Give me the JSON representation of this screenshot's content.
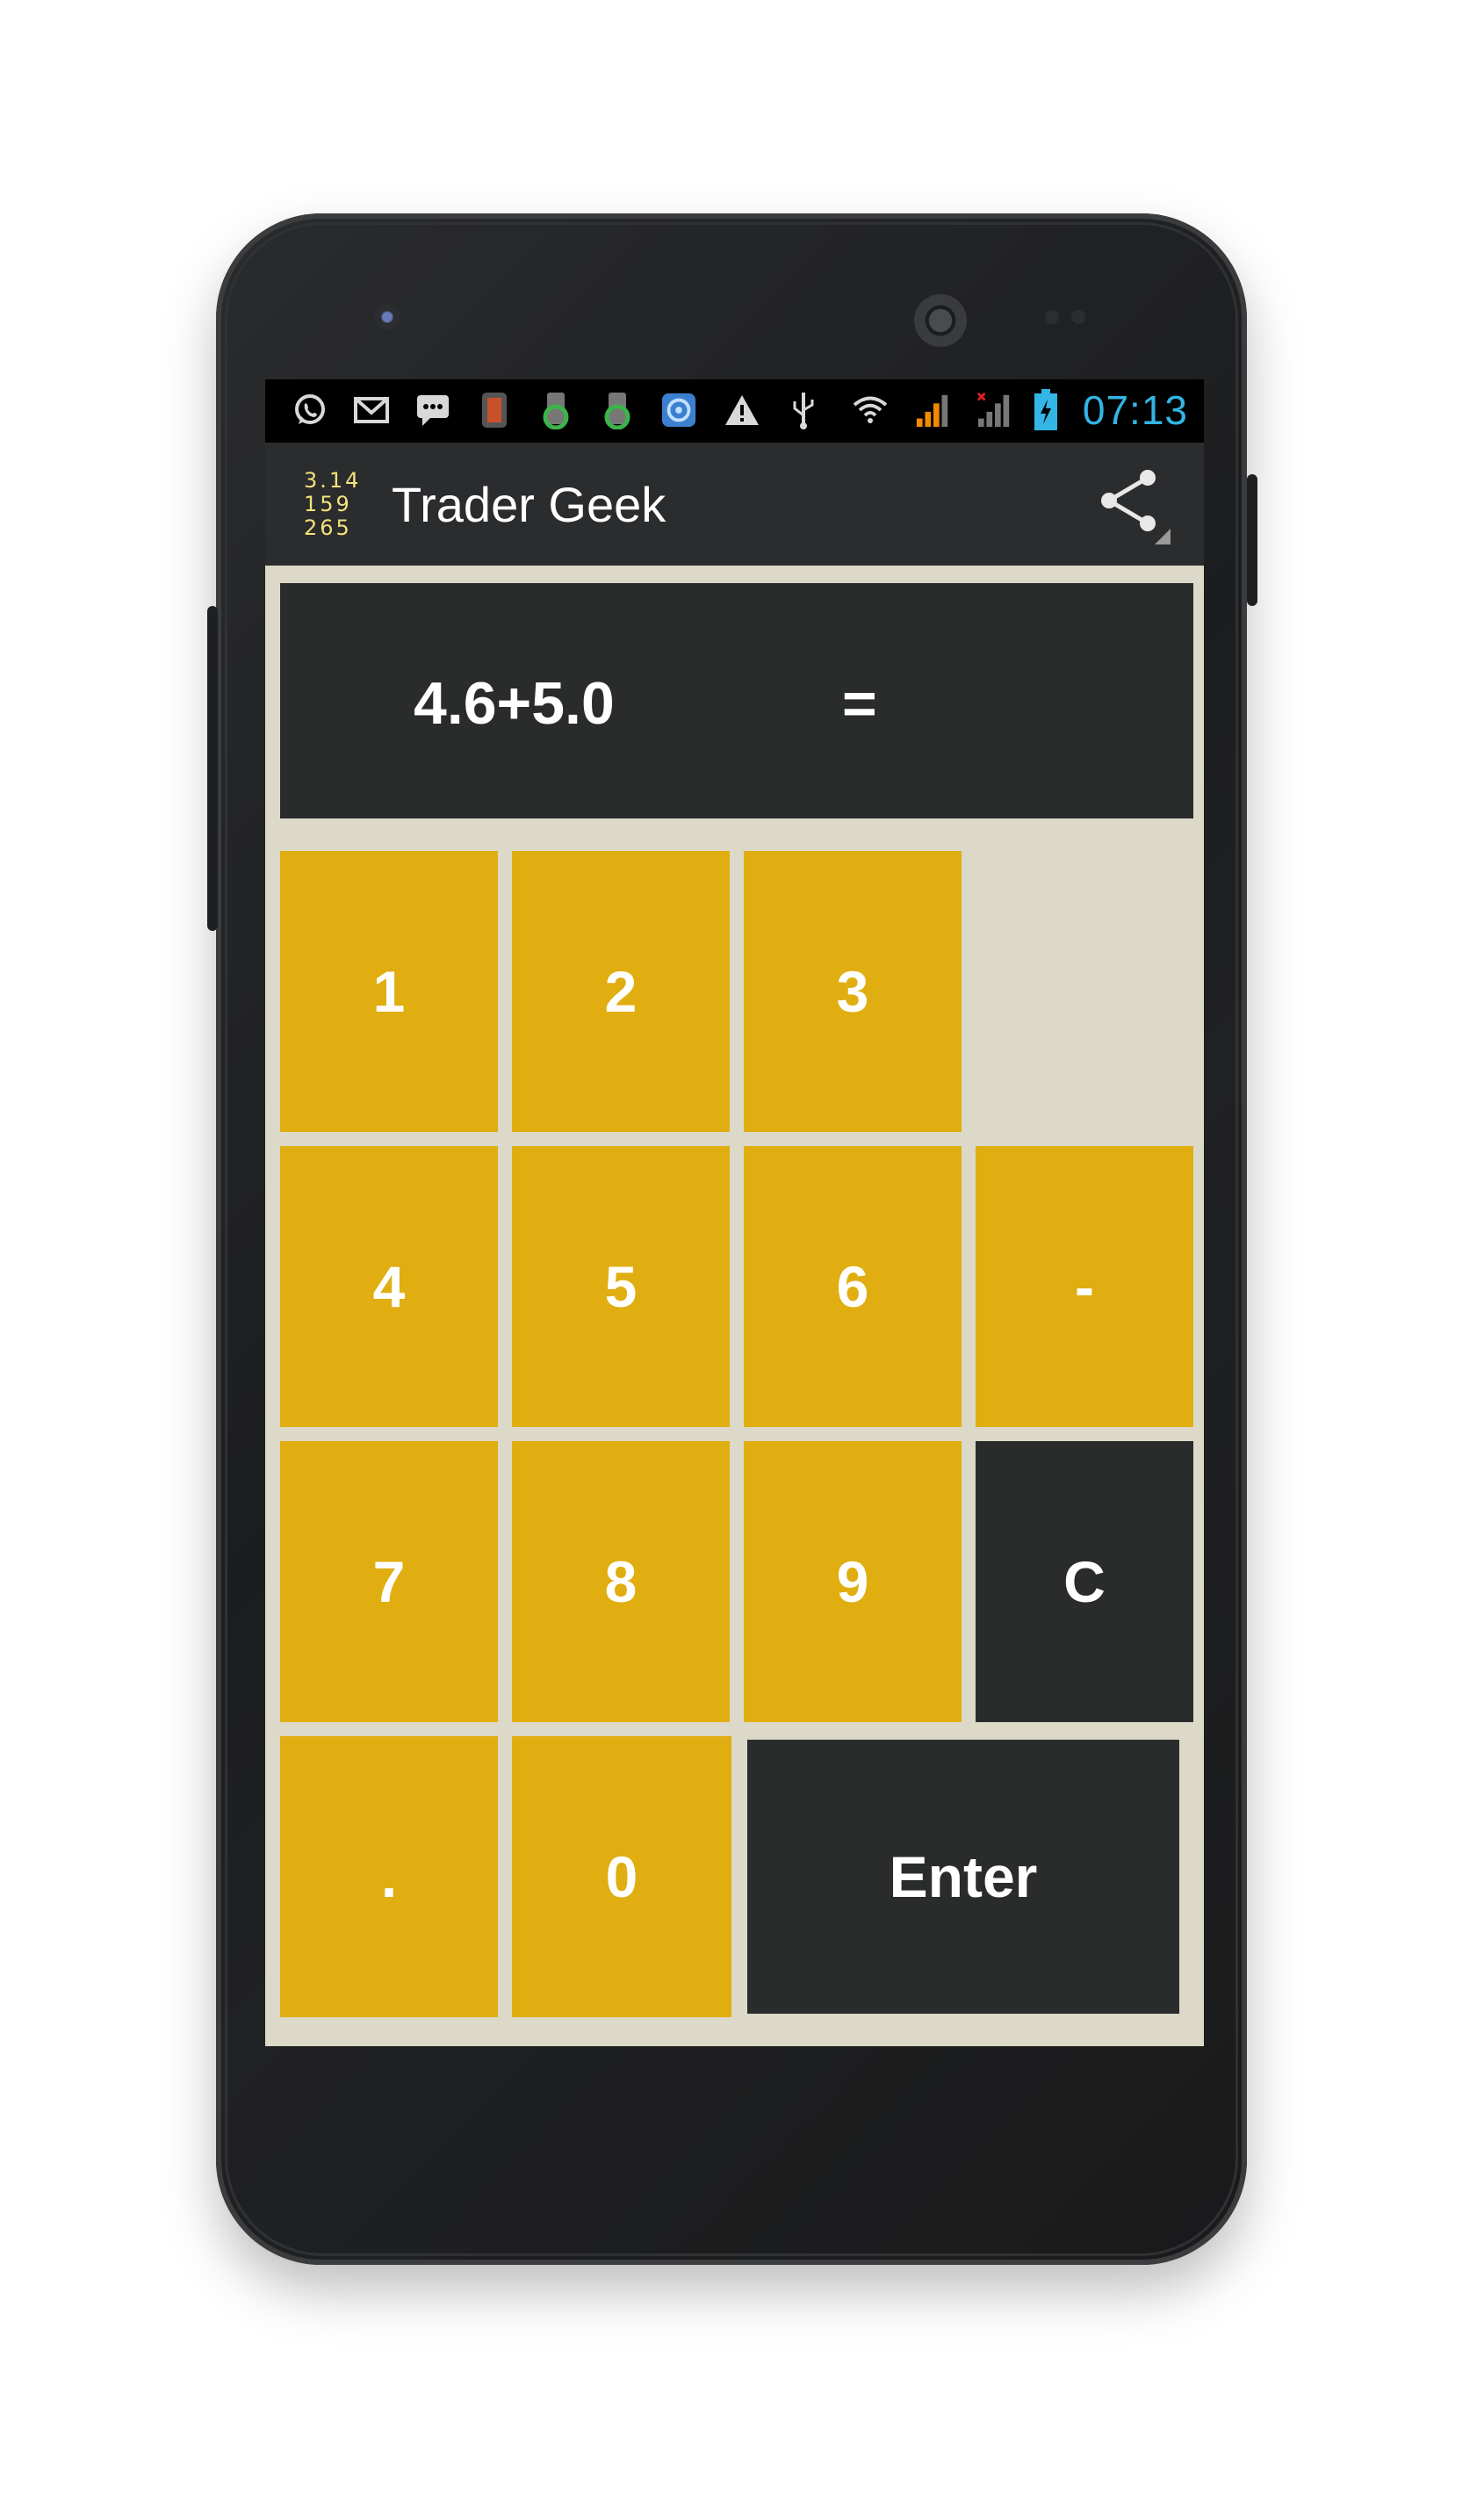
{
  "status_bar": {
    "time": "07:13",
    "icons": [
      "whatsapp-icon",
      "gmail-icon",
      "sms-icon",
      "battery-app-icon",
      "green-app-icon",
      "green-app-icon-2",
      "blue-app-icon",
      "warning-icon",
      "usb-icon",
      "wifi-icon",
      "signal-icon",
      "signal-no-sim-icon",
      "battery-charging-icon"
    ]
  },
  "action_bar": {
    "logo_rows": [
      "3.14",
      "159",
      "265"
    ],
    "title": "Trader Geek",
    "share_icon": "share-icon"
  },
  "display": {
    "expression": "4.6+5.0",
    "equals": "="
  },
  "keypad": {
    "k1": "1",
    "k2": "2",
    "k3": "3",
    "k4": "4",
    "k5": "5",
    "k6": "6",
    "minus": "-",
    "k7": "7",
    "k8": "8",
    "k9": "9",
    "clear": "C",
    "dot": ".",
    "k0": "0",
    "enter": "Enter"
  },
  "colors": {
    "key_yellow": "#e0ae10",
    "key_dark": "#2a2b2b",
    "screen_bg": "#dcd9c8",
    "clock_blue": "#33b5e5"
  }
}
